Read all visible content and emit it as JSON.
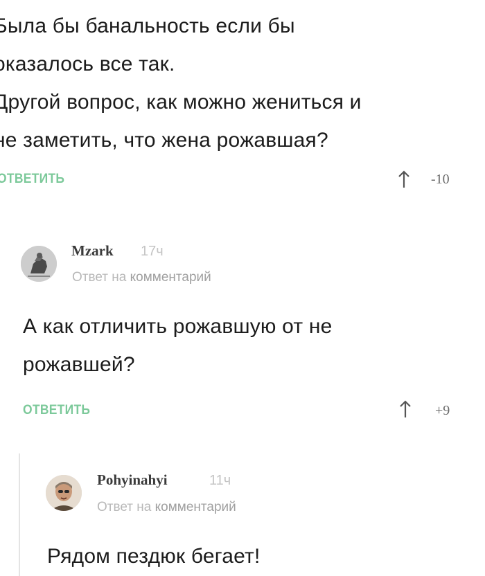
{
  "comments": [
    {
      "text_lines": [
        "Была бы банальность если бы",
        "оказалось все так.",
        "Другой вопрос, как можно жениться и",
        "не заметить, что жена рожавшая?"
      ],
      "reply_label": "ОТВЕТИТЬ",
      "votes": "-10"
    },
    {
      "author": "Mzark",
      "time": "17ч",
      "reply_to_prefix": "Ответ на",
      "reply_to_target": "комментарий",
      "text_lines": [
        "А как отличить рожавшую от не",
        "рожавшей?"
      ],
      "reply_label": "ОТВЕТИТЬ",
      "votes": "+9"
    },
    {
      "author": "Pohyinahyi",
      "time": "11ч",
      "reply_to_prefix": "Ответ на",
      "reply_to_target": "комментарий",
      "text_lines": [
        "Рядом пездюк бегает!"
      ]
    }
  ],
  "colors": {
    "reply_link": "#7cc99a",
    "text": "#1c1c1c",
    "meta": "#b8b8b8"
  },
  "icons": {
    "vote_up": "arrow-up-icon"
  }
}
